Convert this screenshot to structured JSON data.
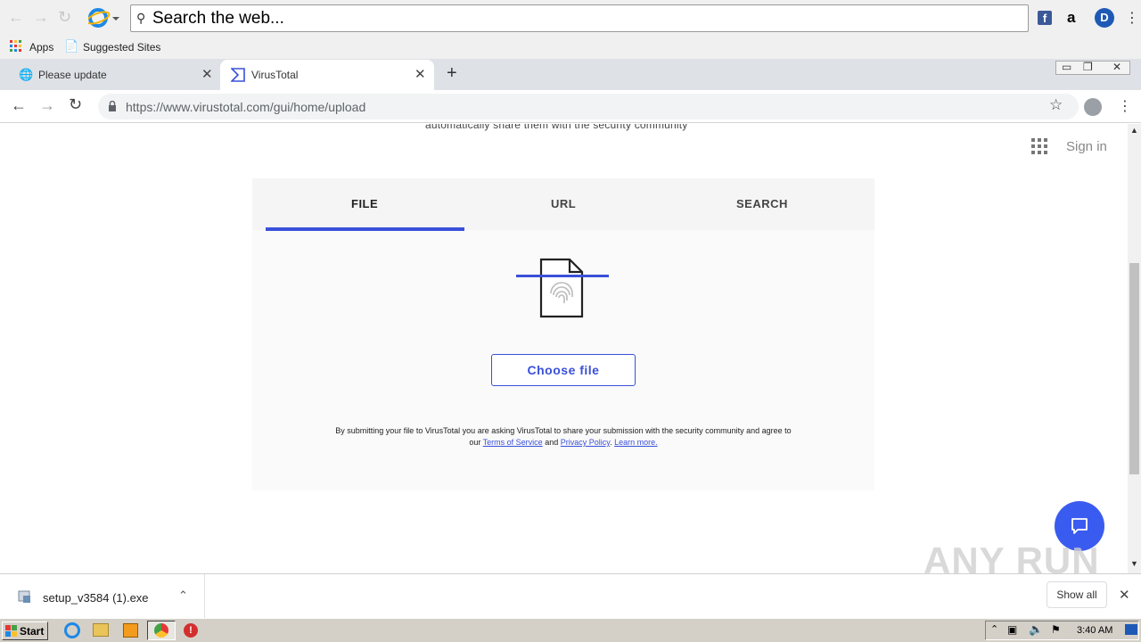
{
  "toolbar": {
    "search_text": "Search the web..."
  },
  "bookmarks": {
    "apps_label": "Apps",
    "suggested_label": "Suggested Sites"
  },
  "tabs": [
    {
      "title": "Please update"
    },
    {
      "title": "VirusTotal"
    }
  ],
  "address": {
    "url": "https://www.virustotal.com/gui/home/upload"
  },
  "page": {
    "subtitle_cut": "automatically share them with the security community",
    "sign_in": "Sign in",
    "tabs": [
      {
        "label": "FILE",
        "active": true
      },
      {
        "label": "URL",
        "active": false
      },
      {
        "label": "SEARCH",
        "active": false
      }
    ],
    "choose_file": "Choose file",
    "terms": {
      "line1": "By submitting your file to VirusTotal you are asking VirusTotal to share your submission with the security community and agree to",
      "our": "our",
      "tos": "Terms of Service",
      "and": "and",
      "privacy": "Privacy Policy",
      "dot": ".",
      "learn_more": "Learn more."
    }
  },
  "downloads": {
    "filename": "setup_v3584 (1).exe",
    "show_all": "Show all"
  },
  "taskbar": {
    "start": "Start",
    "clock": "3:40 AM"
  },
  "watermark": "ANY RUN",
  "colors": {
    "accent": "#3a50d9",
    "chat": "#3a5bf0"
  }
}
